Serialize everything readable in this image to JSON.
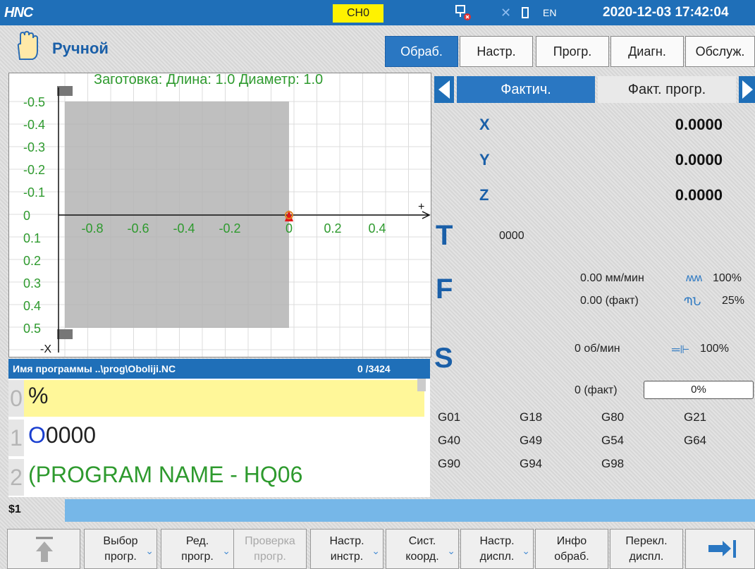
{
  "status_bar": {
    "logo": "HNC",
    "channel": "CH0",
    "lang": "EN",
    "datetime": "2020-12-03 17:42:04"
  },
  "mode": {
    "title": "Ручной"
  },
  "top_buttons": [
    "Обраб.",
    "Настр.",
    "Прогр.",
    "Диагн.",
    "Обслуж."
  ],
  "graph": {
    "blank_label": "Заготовка: Длина: 1.0 Диаметр: 1.0 ",
    "y_ticks": [
      "-0.5",
      "-0.4",
      "-0.3",
      "-0.2",
      "-0.1",
      "0",
      "0.1",
      "0.2",
      "0.3",
      "0.4",
      "0.5"
    ],
    "x_ticks": [
      "-0.8",
      "-0.6",
      "-0.4",
      "-0.2",
      "0",
      "0.2",
      "0.4"
    ],
    "x_axis_label": "-X",
    "z_axis_label": "+"
  },
  "program": {
    "name": "Имя программы  ..\\prog\\Oboliji.NC",
    "line_info": "0  /3424",
    "lines": [
      {
        "num": "0",
        "text": "%"
      },
      {
        "num": "1",
        "text": "O0000"
      },
      {
        "num": "2",
        "text": "(PROGRAM NAME - HQ06"
      }
    ]
  },
  "tabs": {
    "actual": "Фактич.",
    "prog": "Факт. прогр."
  },
  "coords": [
    {
      "axis": "X",
      "value": "0.0000"
    },
    {
      "axis": "Y",
      "value": "0.0000"
    },
    {
      "axis": "Z",
      "value": "0.0000"
    }
  ],
  "tool": {
    "label": "T",
    "value": "0000"
  },
  "feed": {
    "label": "F",
    "value": "0.00 мм/мин",
    "override": "100%",
    "actual": "0.00 (факт)",
    "rapid": "25%"
  },
  "spindle": {
    "label": "S",
    "value": "0 об/мин",
    "override": "100%",
    "actual": "0 (факт)",
    "load": "0%"
  },
  "gcodes": [
    "G01",
    "G18",
    "G80",
    "G21",
    "G40",
    "G49",
    "G54",
    "G64",
    "G90",
    "G94",
    "G98"
  ],
  "command": {
    "label": "$1"
  },
  "softkeys": [
    {
      "label": ""
    },
    {
      "label": "Выбор\nпрогр."
    },
    {
      "label": "Ред.\nпрогр."
    },
    {
      "label": "Проверка\nпрогр."
    },
    {
      "label": "Настр.\nинстр."
    },
    {
      "label": "Сист.\nкоорд."
    },
    {
      "label": "Настр.\nдиспл."
    },
    {
      "label": "Инфо\nобраб."
    },
    {
      "label": "Перекл.\nдиспл."
    },
    {
      "label": ""
    }
  ],
  "colors": {
    "accent": "#1f6fb8",
    "highlight": "#fff799",
    "green": "#2e9a2e"
  }
}
